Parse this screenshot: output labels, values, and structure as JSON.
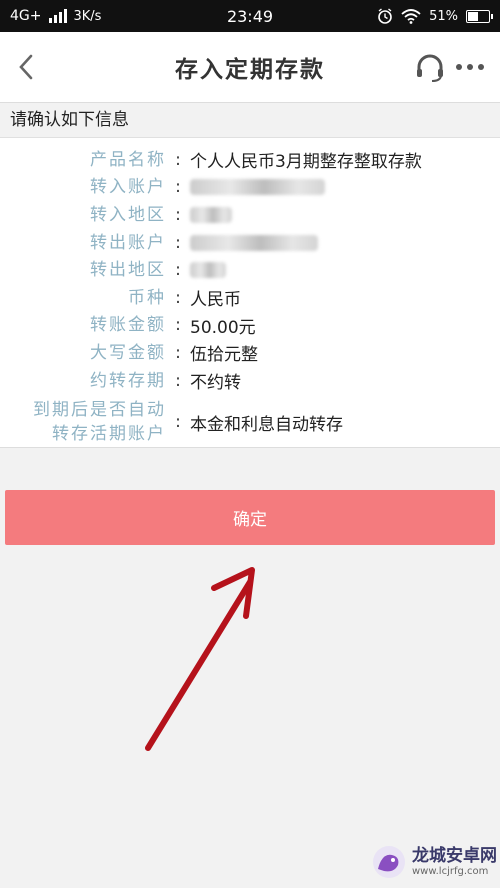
{
  "status_bar": {
    "network": "4G+",
    "speed": "3K/s",
    "time": "23:49",
    "battery": "51%"
  },
  "nav": {
    "title": "存入定期存款",
    "back_icon": "chevron-left-icon",
    "service_icon": "headset-icon",
    "more_icon": "more-dots-icon"
  },
  "section_header": "请确认如下信息",
  "info": {
    "product_name_label": "产品名称",
    "product_name": "个人人民币3月期整存整取存款",
    "in_account_label": "转入账户",
    "in_region_label": "转入地区",
    "out_account_label": "转出账户",
    "out_region_label": "转出地区",
    "currency_label": "币种",
    "currency": "人民币",
    "amount_label": "转账金额",
    "amount": "50.00元",
    "amount_upper_label": "大写金额",
    "amount_upper": "伍拾元整",
    "rollover_term_label": "约转存期",
    "rollover_term": "不约转",
    "auto_transfer_label_line1": "到期后是否自动",
    "auto_transfer_label_line2": "转存活期账户",
    "auto_transfer": "本金和利息自动转存",
    "colon": ":"
  },
  "confirm_button": "确定",
  "watermark": {
    "title": "龙城安卓网",
    "url": "www.lcjrfg.com"
  },
  "colors": {
    "button": "#f47b7e",
    "label": "#8fb3c4",
    "arrow": "#b5121b",
    "statusbar": "#111111"
  }
}
